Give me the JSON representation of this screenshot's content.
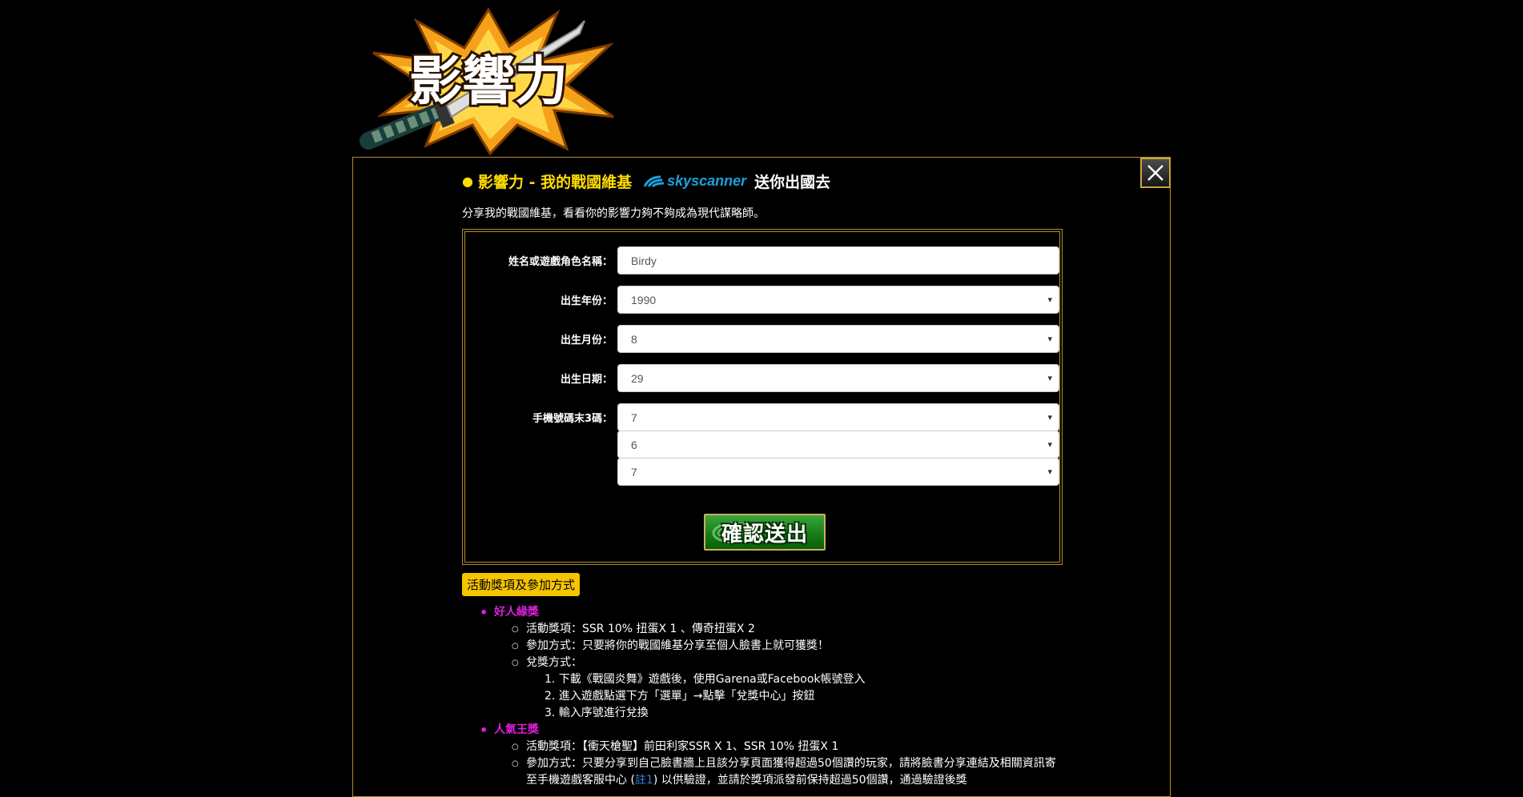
{
  "logo": {
    "text": "影響力"
  },
  "modal": {
    "heading": {
      "bullet": "●",
      "prefix": "影響力 - 我的戰國維基",
      "sponsor": "skyscanner",
      "suffix": "送你出國去"
    },
    "intro": "分享我的戰國維基，看看你的影響力夠不夠成為現代謀略師。",
    "form": {
      "name_label": "姓名或遊戲角色名稱：",
      "name_value": "Birdy",
      "year_label": "出生年份：",
      "year_value": "1990",
      "month_label": "出生月份：",
      "month_value": "8",
      "day_label": "出生日期：",
      "day_value": "29",
      "phone_label": "手機號碼末3碼：",
      "phone_digits": [
        "7",
        "6",
        "7"
      ],
      "submit_label": "確認送出"
    },
    "info_tag": "活動獎項及參加方式",
    "prizes": [
      {
        "title": "好人緣獎",
        "items": [
          "活動獎項：SSR 10% 扭蛋X 1 、傳奇扭蛋X 2",
          "參加方式：只要將你的戰國維基分享至個人臉書上就可獲獎！",
          "兌獎方式："
        ],
        "steps": [
          "1. 下載《戰國炎舞》遊戲後，使用Garena或Facebook帳號登入",
          "2. 進入遊戲點選下方「選單」→點擊「兌獎中心」按鈕",
          "3. 輸入序號進行兌換"
        ]
      },
      {
        "title": "人氣王獎",
        "items": [
          "活動獎項：【衝天槍聖】前田利家SSR X 1、SSR 10% 扭蛋X 1"
        ],
        "long_item_start": "參加方式：只要分享到自己臉書牆上且該分享頁面獲得超過50個讚的玩家，請將臉書分享連結及相關資訊寄至手機遊戲客服中心 (",
        "long_item_note": "註1",
        "long_item_end": ") 以供驗證，並請於獎項派發前保持超過50個讚，通過驗證後獎"
      }
    ]
  },
  "icons": {
    "close": "close-x-icon",
    "select_arrow": "▾"
  },
  "colors": {
    "accent_yellow": "#ffdc00",
    "gold_border": "#b08d2a",
    "prize_magenta": "#e01ee0",
    "skyscanner_blue": "#19a3dd",
    "submit_green": "#167f16"
  }
}
